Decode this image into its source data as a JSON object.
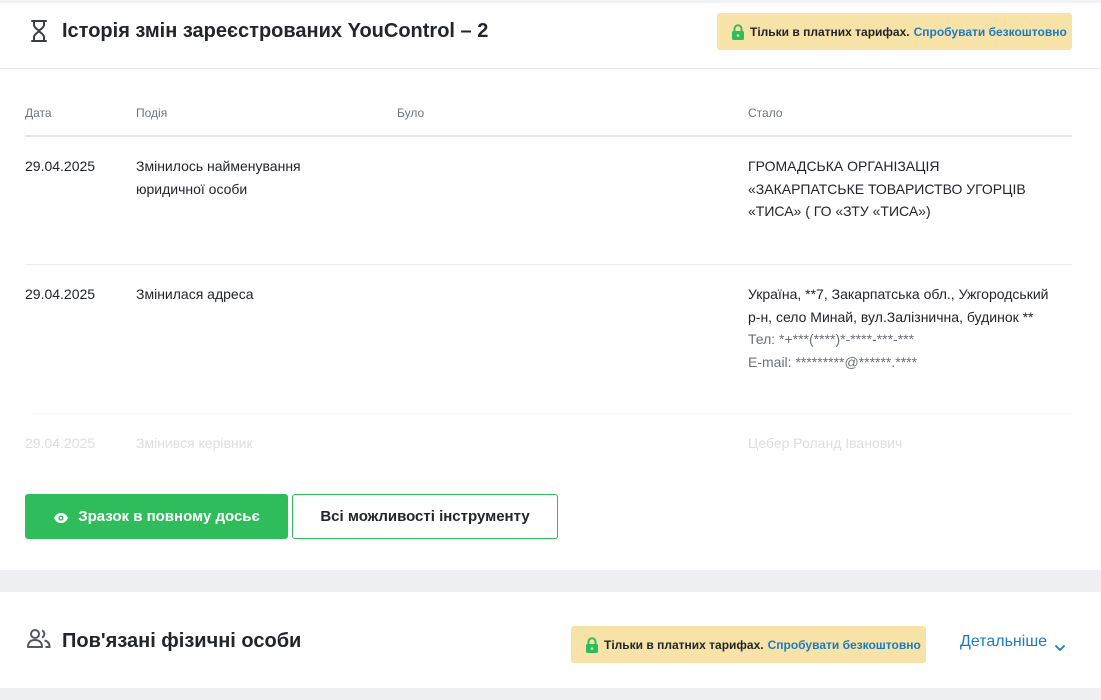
{
  "history": {
    "title": "Історія змін зареєстрованих YouControl – 2",
    "icon": "hourglass-icon",
    "paid_badge": {
      "text": "Тільки в платних тарифах.",
      "link": "Спробувати безкоштовно"
    },
    "columns": {
      "date": "Дата",
      "event": "Подія",
      "was": "Було",
      "became": "Стало"
    },
    "rows": [
      {
        "date": "29.04.2025",
        "event": "Змінилось найменування юридичної особи",
        "was": "",
        "became": "ГРОМАДСЬКА ОРГАНІЗАЦІЯ «ЗАКАРПАТСЬКЕ ТОВАРИСТВО УГОРЦІВ «ТИСА» ( ГО «ЗТУ «ТИСА»)"
      },
      {
        "date": "29.04.2025",
        "event": "Змінилася адреса",
        "was": "",
        "became": "Україна, **7, Закарпатська обл., Ужгородський р-н, село Минай, вул.Залізнична, будинок **",
        "phone": "Тел: *+***(****)*-****-***-***",
        "email": "E-mail: *********@******.****"
      },
      {
        "date": "29.04.2025",
        "event": "Змінився керівник",
        "was": "",
        "became": "Цебер Роланд Іванович"
      }
    ],
    "buttons": {
      "sample": "Зразок в повному досьє",
      "features": "Всі можливості інструменту"
    }
  },
  "related": {
    "title": "Пов'язані фізичні особи",
    "icon": "people-icon",
    "paid_badge": {
      "text": "Тільки в платних тарифах.",
      "link": "Спробувати безкоштовно"
    },
    "details_link": "Детальніше"
  },
  "colors": {
    "accent_green": "#2fbd5c",
    "link_blue": "#1a7bc2",
    "badge_bg": "#f7e2a7"
  }
}
